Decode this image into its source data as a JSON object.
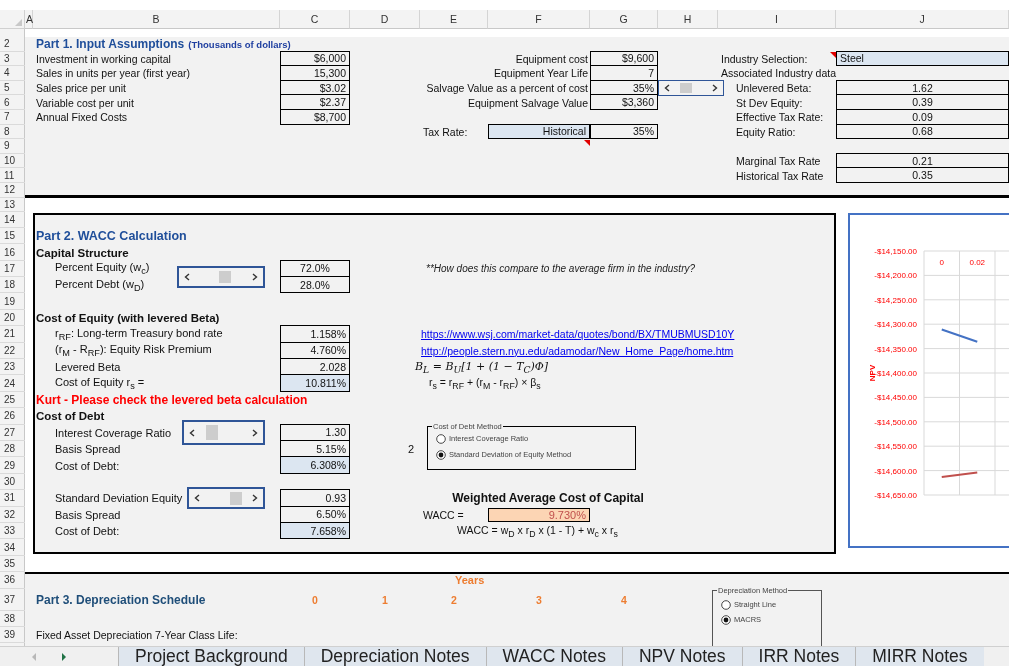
{
  "column_headers": [
    "A",
    "B",
    "C",
    "D",
    "E",
    "F",
    "G",
    "H",
    "I",
    "J"
  ],
  "row_numbers": [
    "2",
    "3",
    "4",
    "5",
    "6",
    "7",
    "8",
    "9",
    "10",
    "11",
    "12",
    "13",
    "14",
    "15",
    "16",
    "17",
    "18",
    "19",
    "20",
    "21",
    "22",
    "23",
    "24",
    "25",
    "26",
    "27",
    "28",
    "29",
    "30",
    "31",
    "32",
    "33",
    "34",
    "35",
    "36",
    "37",
    "38",
    "39"
  ],
  "part1": {
    "title": "Part 1. Input Assumptions",
    "subtitle": "(Thousands of dollars)",
    "inputs": [
      {
        "label": "Investment in working capital",
        "value": "$6,000"
      },
      {
        "label": "Sales in units per year (first year)",
        "value": "15,300"
      },
      {
        "label": "Sales price per unit",
        "value": "$3.02"
      },
      {
        "label": "Variable cost per unit",
        "value": "$2.37"
      },
      {
        "label": "Annual Fixed Costs",
        "value": "$8,700"
      }
    ],
    "equipment": [
      {
        "label": "Equipment cost",
        "value": "$9,600"
      },
      {
        "label": "Equipment Year Life",
        "value": "7"
      },
      {
        "label": "Salvage Value as a percent of cost",
        "value": "35%"
      },
      {
        "label": "Equipment Salvage Value",
        "value": "$3,360"
      }
    ],
    "tax_rate": {
      "label": "Tax Rate:",
      "choice": "Historical",
      "value": "35%"
    },
    "industry": {
      "label": "Industry Selection:",
      "value": "Steel",
      "heading": "Associated Industry data"
    },
    "industry_data": [
      {
        "label": "Unlevered Beta:",
        "value": "1.62"
      },
      {
        "label": "St Dev Equity:",
        "value": "0.39"
      },
      {
        "label": "Effective Tax Rate:",
        "value": "0.09"
      },
      {
        "label": "Equity Ratio:",
        "value": "0.68"
      },
      {
        "label": "Marginal Tax Rate",
        "value": "0.21"
      },
      {
        "label": "Historical Tax Rate",
        "value": "0.35"
      }
    ]
  },
  "part2": {
    "title": "Part 2. WACC Calculation",
    "capital_structure": {
      "heading": "Capital Structure",
      "rows": [
        {
          "label": "Percent Equity (w$_{c}$)",
          "value": "72.0%"
        },
        {
          "label": "Percent Debt (w$_{D}$)",
          "value": "28.0%"
        }
      ]
    },
    "note": "**How does this compare to the average firm in the industry?",
    "cost_of_equity": {
      "heading": "Cost of Equity (with levered Beta)",
      "rows": [
        {
          "label": "r$_{RF}$: Long-term Treasury bond rate",
          "value": "1.158%",
          "highlighted": false
        },
        {
          "label": "(r$_{M}$ - R$_{RF}$): Equity Risk Premium",
          "value": "4.760%",
          "highlighted": false
        },
        {
          "label": "Levered Beta",
          "value": "2.028",
          "highlighted": false
        },
        {
          "label": "Cost of Equity r$_{s}$ =",
          "value": "10.811%",
          "highlighted": true
        }
      ]
    },
    "links": [
      "https://www.wsj.com/market-data/quotes/bond/BX/TMUBMUSD10Y",
      "http://people.stern.nyu.edu/adamodar/New_Home_Page/home.htm"
    ],
    "levered_beta_formula": "B$_{L}$ =  B$_{U}$[1 +  (1 − T$_{C}$)Φ]",
    "cost_of_equity_formula": "r$_{s}$ = r$_{RF}$ + (r$_{M}$ - r$_{RF}$) × β$_{s}$",
    "warning": "Kurt - Please check the levered beta calculation",
    "cost_of_debt": {
      "heading": "Cost of Debt",
      "methods": [
        {
          "rows": [
            {
              "label": "Interest Coverage Ratio",
              "value": "1.30",
              "highlighted": false
            },
            {
              "label": "Basis Spread",
              "value": "5.15%",
              "highlighted": false
            },
            {
              "label": "Cost of Debt:",
              "value": "6.308%",
              "highlighted": true
            }
          ]
        },
        {
          "rows": [
            {
              "label": "Standard Deviation Equity",
              "value": "0.93",
              "highlighted": false
            },
            {
              "label": "Basis Spread",
              "value": "6.50%",
              "highlighted": false
            },
            {
              "label": "Cost of Debt:",
              "value": "7.658%",
              "highlighted": true
            }
          ]
        }
      ]
    },
    "debt_method_group": {
      "title": "Cost of Debt Method",
      "linked_value": "2",
      "options": [
        {
          "label": "Interest Coverage Ratio",
          "selected": false
        },
        {
          "label": "Standard Deviation of Equity Method",
          "selected": true
        }
      ]
    },
    "wacc": {
      "heading": "Weighted Average Cost of Capital",
      "label": "WACC =",
      "value": "9.730%",
      "formula": "WACC = w$_{D}$ x r$_{D}$ x (1 - T) + w$_{c}$ x r$_{s}$"
    }
  },
  "chart": {
    "chart_data": {
      "type": "line",
      "grid": true,
      "ylabel": "NPV",
      "categories": [
        "0",
        "0.02"
      ],
      "series": [
        {
          "color": "#4472c4",
          "values": [
            -14311,
            -14336
          ]
        },
        {
          "color": "#c0504d",
          "values": [
            -14613,
            -14604
          ]
        }
      ],
      "ylim": [
        -14650,
        -14150
      ],
      "yticks": [
        {
          "value": -14150,
          "label": "-$14,150.00"
        },
        {
          "value": -14200,
          "label": "-$14,200.00"
        },
        {
          "value": -14250,
          "label": "-$14,250.00"
        },
        {
          "value": -14300,
          "label": "-$14,300.00"
        },
        {
          "value": -14350,
          "label": "-$14,350.00"
        },
        {
          "value": -14400,
          "label": "-$14,400.00"
        },
        {
          "value": -14450,
          "label": "-$14,450.00"
        },
        {
          "value": -14500,
          "label": "-$14,500.00"
        },
        {
          "value": -14550,
          "label": "-$14,550.00"
        },
        {
          "value": -14600,
          "label": "-$14,600.00"
        },
        {
          "value": -14650,
          "label": "-$14,650.00"
        }
      ]
    }
  },
  "part3": {
    "years_label": "Years",
    "title": "Part 3. Depreciation Schedule",
    "years": [
      "0",
      "1",
      "2",
      "3",
      "4"
    ],
    "row_label": "Fixed Asset Depreciation 7-Year Class Life:",
    "method_group": {
      "title": "Depreciation Method",
      "options": [
        {
          "label": "Straight Line",
          "selected": false
        },
        {
          "label": "MACRS",
          "selected": true
        }
      ]
    }
  },
  "sheet_tabs": [
    {
      "label": "Project Background",
      "selected": false
    },
    {
      "label": "Depreciation Notes",
      "selected": false
    },
    {
      "label": "WACC Notes",
      "selected": false
    },
    {
      "label": "NPV Notes",
      "selected": false
    },
    {
      "label": "IRR Notes",
      "selected": false
    },
    {
      "label": "MIRR Notes",
      "selected": false
    }
  ]
}
